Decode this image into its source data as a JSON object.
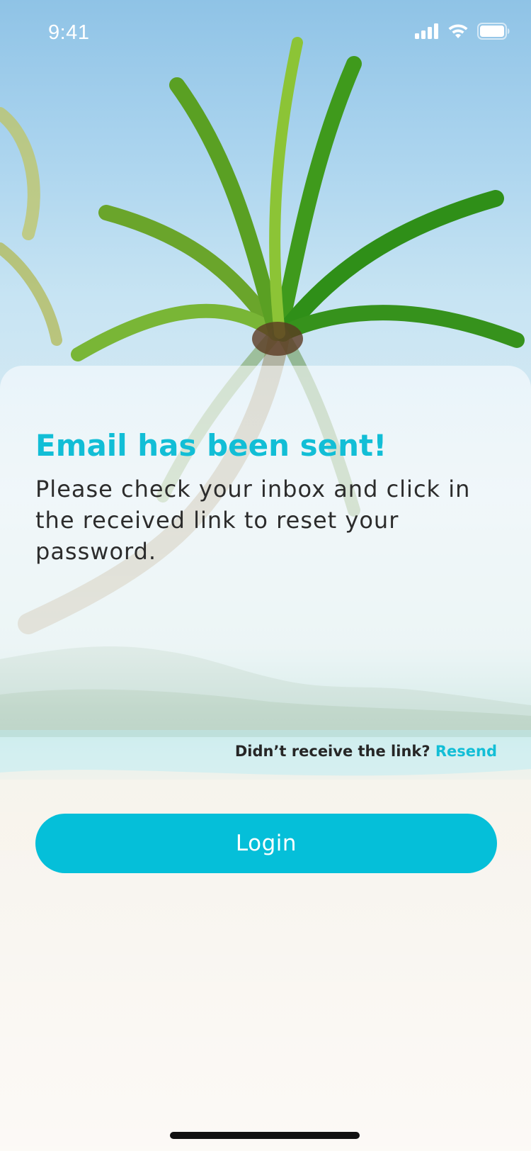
{
  "status_bar": {
    "time": "9:41",
    "icons": [
      "cellular-signal-icon",
      "wifi-icon",
      "battery-icon"
    ]
  },
  "background": {
    "description_icon": "palm-tree-beach-photo"
  },
  "sheet": {
    "title": "Email has been sent!",
    "message": "Please check your inbox and click in the received link to reset your password.",
    "resend_prompt": "Didn’t receive the link?",
    "resend_link": "Resend",
    "login_button": "Login"
  },
  "colors": {
    "accent": "#12BED6",
    "button": "#05BFD9",
    "text": "#2C2C2C"
  }
}
